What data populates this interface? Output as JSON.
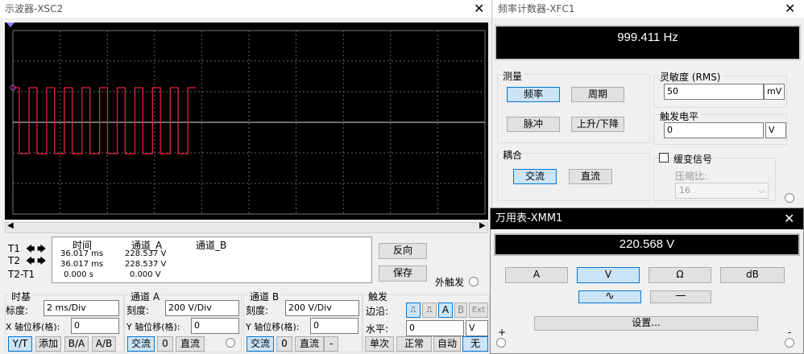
{
  "scope": {
    "title": "示波器-XSC2",
    "readout": {
      "headers": [
        "时间",
        "通道_A",
        "通道_B"
      ],
      "rows": [
        {
          "label": "T1",
          "time": "36.017 ms",
          "a": "228.537 V",
          "b": ""
        },
        {
          "label": "T2",
          "time": "36.017 ms",
          "a": "228.537 V",
          "b": ""
        },
        {
          "label": "T2-T1",
          "time": "0.000 s",
          "a": "0.000 V",
          "b": ""
        }
      ]
    },
    "reverse_label": "反向",
    "save_label": "保存",
    "ext_trigger_label": "外触发",
    "timebase": {
      "title": "时基",
      "scale_label": "标度:",
      "scale_value": "2 ms/Div",
      "xpos_label": "X 轴位移(格):",
      "xpos_value": "0",
      "modes": [
        "Y/T",
        "添加",
        "B/A",
        "A/B"
      ]
    },
    "channel_a": {
      "title": "通道 A",
      "scale_label": "刻度:",
      "scale_value": "200  V/Div",
      "ypos_label": "Y 轴位移(格):",
      "ypos_value": "0",
      "coupling": [
        "交流",
        "0",
        "直流"
      ]
    },
    "channel_b": {
      "title": "通道 B",
      "scale_label": "刻度:",
      "scale_value": "200  V/Div",
      "ypos_label": "Y 轴位移(格):",
      "ypos_value": "0",
      "coupling": [
        "交流",
        "0",
        "直流",
        "-"
      ]
    },
    "trigger": {
      "title": "触发",
      "edge_label": "边沿:",
      "sources": [
        "A",
        "B",
        "Ext"
      ],
      "level_label": "水平:",
      "level_value": "0",
      "level_unit": "V",
      "modes": [
        "单次",
        "正常",
        "自动",
        "无"
      ]
    },
    "waveform": {
      "pulses": 10,
      "high_fraction": 0.55
    }
  },
  "counter": {
    "title": "频率计数器-XFC1",
    "display": "999.411 Hz",
    "measure": {
      "title": "测量",
      "buttons": [
        "频率",
        "周期",
        "脉冲",
        "上升/下降"
      ]
    },
    "coupling": {
      "title": "耦合",
      "buttons": [
        "交流",
        "直流"
      ]
    },
    "sensitivity": {
      "title": "灵敏度 (RMS)",
      "value": "50",
      "unit": "mV"
    },
    "trigger_level": {
      "title": "触发电平",
      "value": "0",
      "unit": "V"
    },
    "slow_signal": {
      "label": "缓变信号",
      "ratio_label": "压缩比:",
      "ratio_value": "16"
    }
  },
  "multimeter": {
    "title": "万用表-XMM1",
    "display": "220.568 V",
    "modes": [
      "A",
      "V",
      "Ω",
      "dB"
    ],
    "settings_label": "设置...",
    "plus": "+",
    "minus": "-"
  }
}
